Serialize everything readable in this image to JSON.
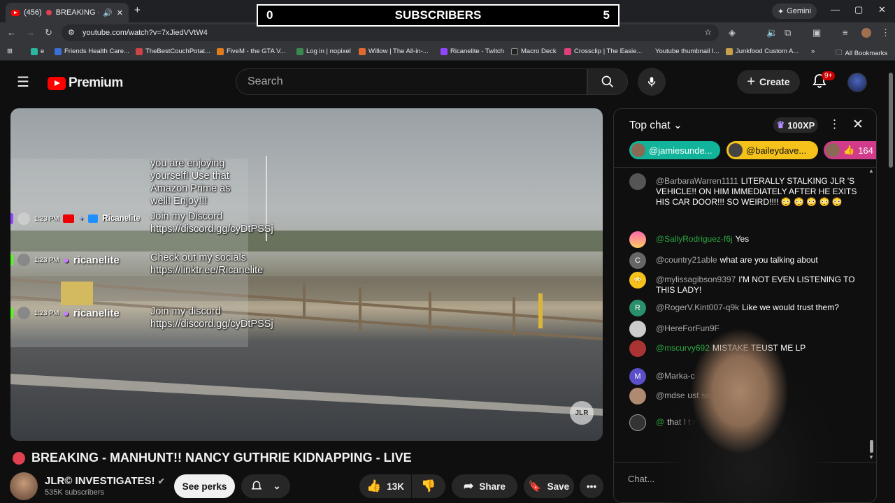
{
  "browser": {
    "tab_count": "(456)",
    "tab_title": "BREAKING - MAN",
    "url": "youtube.com/watch?v=7xJiedVVtW4",
    "gemini_label": "Gemini",
    "bookmarks": [
      "e",
      "Friends Health Care...",
      "TheBestCouchPotat...",
      "FiveM - the GTA V...",
      "Log in | nopixel",
      "Willow | The All-in-...",
      "Ricanelite - Twitch",
      "Macro Deck",
      "Crossclip | The Easie...",
      "Youtube thumbnail I...",
      "Junkfood Custom A..."
    ],
    "all_bookmarks": "All Bookmarks"
  },
  "overlay": {
    "left": "0",
    "title": "SUBSCRIBERS",
    "right": "5"
  },
  "youtube": {
    "logo": "Premium",
    "search_placeholder": "Search",
    "create_label": "Create",
    "notif_count": "9+"
  },
  "stream_chat_overlay": [
    {
      "text": "you are enjoying yourself! Use that Amazon Prime as well! Enjoy!!!"
    },
    {
      "time": "1:23 PM",
      "user": "Ricanelite",
      "text": "Join my Discord https://discord.gg/cyDtPSSj"
    },
    {
      "time": "1:23 PM",
      "user": "ricanelite",
      "text": "Check out my socials https://linktr.ee/Ricanelite"
    },
    {
      "time": "1:23 PM",
      "user": "ricanelite",
      "text": "Join my discord https://discord.gg/cyDtPSSj"
    }
  ],
  "video": {
    "watermark": "JLR",
    "title": "BREAKING - MANHUNT!! NANCY GUTHRIE KIDNAPPING - LIVE",
    "channel": "JLR© INVESTIGATES!",
    "subscribers": "535K subscribers",
    "see_perks": "See perks",
    "likes": "13K",
    "share": "Share",
    "save": "Save"
  },
  "chat": {
    "header": "Top chat",
    "xp": "100XP",
    "chips": [
      "@jamiesunde...",
      "@baileydave...",
      "164"
    ],
    "messages": [
      {
        "author": "@BarbaraWarren1111",
        "text": "LITERALLY STALKING JLR 'S VEHICLE!! ON HIM IMMEDIATELY AFTER HE EXITS HIS CAR DOOR!!! SO WEIRD!!!! 😳 😳 😳 😳 😳",
        "green": false,
        "avatar": ""
      },
      {
        "author": "@SallyRodriguez-f6j",
        "text": "Yes",
        "green": true,
        "avatar": ""
      },
      {
        "author": "@country21able",
        "text": "what are you talking about",
        "green": false,
        "avatar": "C"
      },
      {
        "author": "@mylissagibson9397",
        "text": "I'M NOT EVEN LISTENING TO THIS LADY!",
        "green": false,
        "avatar": "😳"
      },
      {
        "author": "@RogerV.Kint007-q9k",
        "text": "Like we would trust them?",
        "green": false,
        "avatar": "R"
      },
      {
        "author": "@HereForFun9F",
        "text": "",
        "green": false,
        "avatar": ""
      },
      {
        "author": "@mscurvy692",
        "text": "MISTAKE TEUST ME LP",
        "green": true,
        "avatar": ""
      },
      {
        "author": "@Marka-c",
        "text": "",
        "green": false,
        "avatar": "M"
      },
      {
        "author": "@mdse",
        "text": "ust say ok bye",
        "green": false,
        "avatar": ""
      },
      {
        "author": "@",
        "text": "that I t de job a de. It's s",
        "green": true,
        "avatar": ""
      }
    ],
    "input_placeholder": "Chat..."
  },
  "colors": {
    "accent_red": "#ff0000",
    "bg": "#0f0f0f",
    "chip_teal": "#12b39b",
    "chip_yellow": "#f4c21a",
    "chip_pink": "#d23b8a"
  }
}
